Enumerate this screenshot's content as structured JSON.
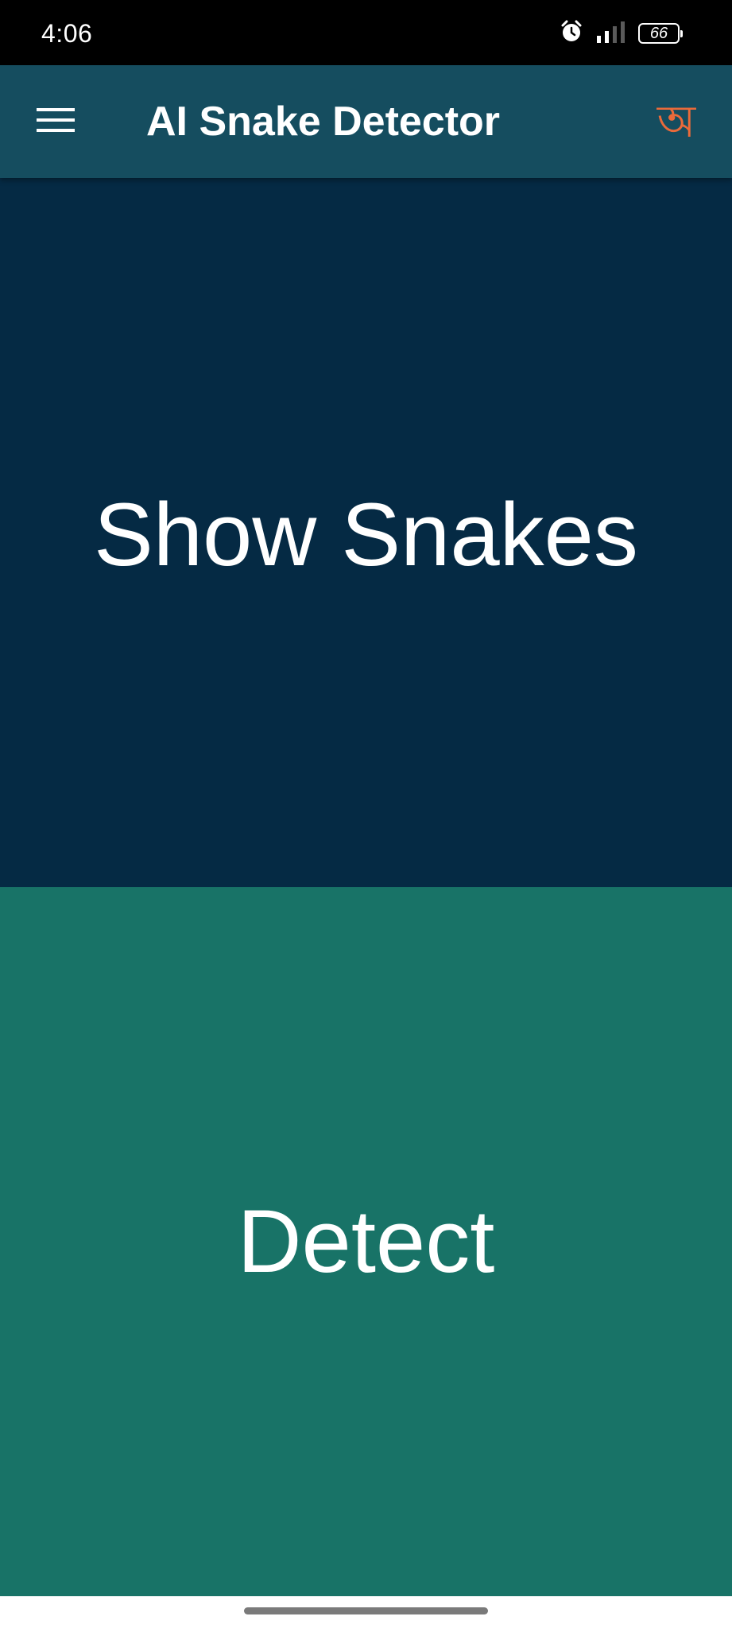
{
  "status_bar": {
    "time": "4:06",
    "battery_level": "66",
    "icons": [
      "alarm-icon",
      "signal-icon",
      "battery-icon"
    ]
  },
  "app_bar": {
    "title": "AI Snake Detector",
    "menu_icon": "hamburger-menu-icon",
    "language_label": "অ"
  },
  "main": {
    "show_snakes_label": "Show Snakes",
    "detect_label": "Detect"
  },
  "colors": {
    "status_bar": "#000000",
    "app_bar": "#154d5f",
    "show_snakes_panel": "#052a44",
    "detect_panel": "#187367",
    "language_accent": "#ea6a3a",
    "text": "#ffffff"
  }
}
